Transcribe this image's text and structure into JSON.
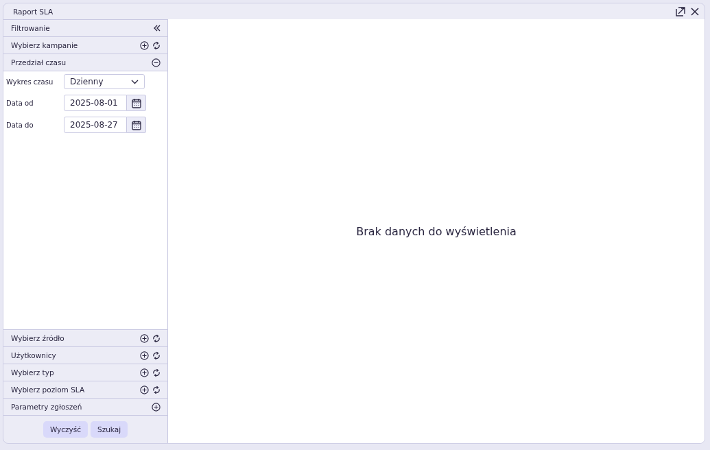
{
  "window": {
    "title": "Raport SLA"
  },
  "sidebar": {
    "title": "Filtrowanie",
    "sections": [
      {
        "label": "Wybierz kampanie",
        "kind": "multi",
        "expanded": false
      },
      {
        "label": "Przedział czasu",
        "kind": "single",
        "expanded": true,
        "fields": [
          {
            "label": "Wykres czasu",
            "kind": "select",
            "value": "Dzienny"
          },
          {
            "label": "Data od",
            "kind": "date",
            "value": "2025-08-01"
          },
          {
            "label": "Data do",
            "kind": "date",
            "value": "2025-08-27"
          }
        ]
      },
      {
        "label": "Wybierz źródło",
        "kind": "multi",
        "expanded": false
      },
      {
        "label": "Użytkownicy",
        "kind": "multi",
        "expanded": false
      },
      {
        "label": "Wybierz typ",
        "kind": "multi",
        "expanded": false
      },
      {
        "label": "Wybierz poziom SLA",
        "kind": "multi",
        "expanded": false
      },
      {
        "label": "Parametry zgłoszeń",
        "kind": "single",
        "expanded": false
      }
    ],
    "buttons": [
      "Wyczyść",
      "Szukaj"
    ]
  },
  "main": {
    "empty_message": "Brak danych do wyświetlenia"
  }
}
